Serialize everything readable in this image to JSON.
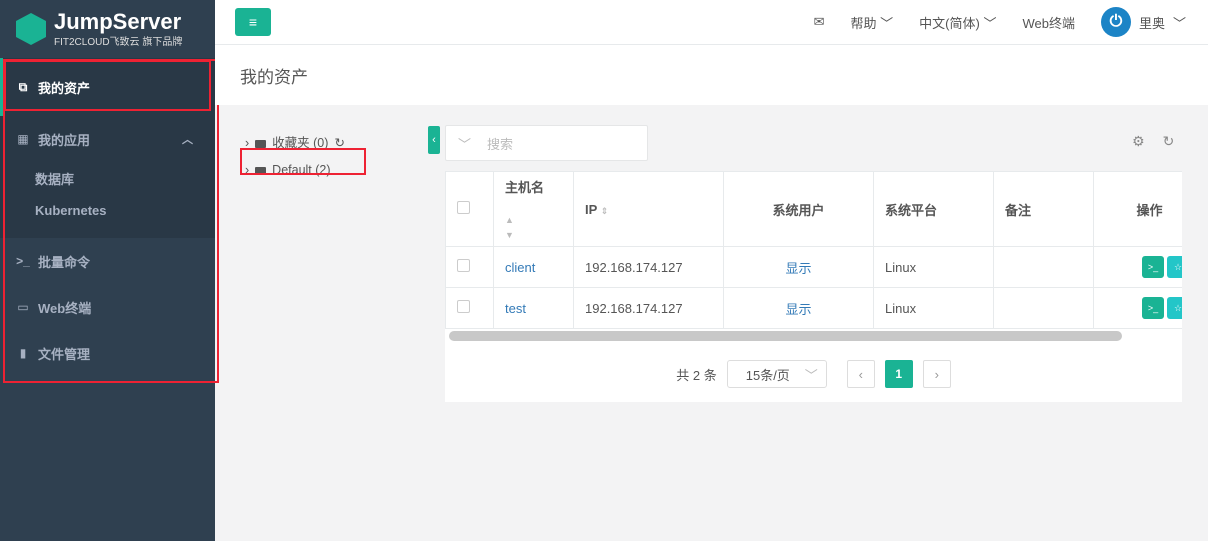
{
  "brand": {
    "name": "JumpServer",
    "tagline": "FIT2CLOUD飞致云 旗下品牌"
  },
  "sidebar": {
    "items": [
      {
        "label": "我的资产",
        "icon": "assets-icon"
      },
      {
        "label": "我的应用",
        "icon": "grid-icon",
        "children": [
          "数据库",
          "Kubernetes"
        ]
      },
      {
        "label": "批量命令",
        "icon": "terminal-icon"
      },
      {
        "label": "Web终端",
        "icon": "window-icon"
      },
      {
        "label": "文件管理",
        "icon": "file-icon"
      }
    ]
  },
  "topbar": {
    "help": "帮助",
    "language": "中文(简体)",
    "web_terminal": "Web终端",
    "user": "里奥"
  },
  "page": {
    "title": "我的资产"
  },
  "tree": [
    {
      "label": "收藏夹 (0)"
    },
    {
      "label": "Default (2)"
    }
  ],
  "search": {
    "placeholder": "搜索"
  },
  "table": {
    "headers": [
      "主机名",
      "IP",
      "系统用户",
      "系统平台",
      "备注",
      "操作"
    ],
    "rows": [
      {
        "hostname": "client",
        "ip": "192.168.174.127",
        "system_user": "显示",
        "platform": "Linux",
        "comment": ""
      },
      {
        "hostname": "test",
        "ip": "192.168.174.127",
        "system_user": "显示",
        "platform": "Linux",
        "comment": ""
      }
    ]
  },
  "pagination": {
    "total": "共 2 条",
    "page_size": "15条/页",
    "current": "1"
  }
}
